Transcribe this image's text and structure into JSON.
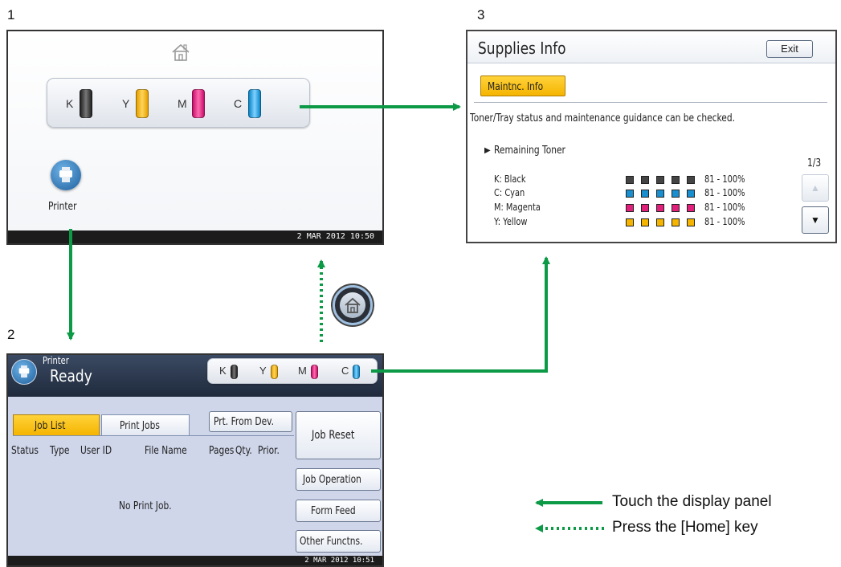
{
  "labels": {
    "n1": "1",
    "n2": "2",
    "n3": "3"
  },
  "screen1": {
    "toner": [
      {
        "key": "K",
        "color": "#3a3a3a"
      },
      {
        "key": "Y",
        "color": "#f5b400"
      },
      {
        "key": "M",
        "color": "#e0207a"
      },
      {
        "key": "C",
        "color": "#1aa0e0"
      }
    ],
    "printer_label": "Printer",
    "datetime": "2 MAR   2012 10:50"
  },
  "screen2": {
    "app_label": "Printer",
    "status": "Ready",
    "toner": [
      "K",
      "Y",
      "M",
      "C"
    ],
    "tabs": [
      "Job List",
      "Print Jobs"
    ],
    "prt_from_dev": "Prt. From Dev.",
    "columns": [
      "Status",
      "Type",
      "User ID",
      "File Name",
      "Pages",
      "Qty.",
      "Prior."
    ],
    "empty_message": "No Print Job.",
    "job_reset": "Job Reset",
    "job_operation": "Job Operation",
    "form_feed": "Form Feed",
    "other_functns": "Other Functns.",
    "datetime": "2 MAR   2012 10:51"
  },
  "screen3": {
    "title": "Supplies Info",
    "exit": "Exit",
    "maint_tab": "Maintnc. Info",
    "description": "Toner/Tray status and maintenance guidance can be checked.",
    "section": "Remaining Toner",
    "page": "1/3",
    "rows": [
      {
        "label": "K: Black",
        "color": "#444444",
        "level": "81 - 100%"
      },
      {
        "label": "C: Cyan",
        "color": "#1a8fd0",
        "level": "81 - 100%"
      },
      {
        "label": "M: Magenta",
        "color": "#e0207a",
        "level": "81 - 100%"
      },
      {
        "label": "Y: Yellow",
        "color": "#f5b400",
        "level": "81 - 100%"
      }
    ]
  },
  "legend": {
    "touch": "Touch the display panel",
    "press": "Press the [Home] key"
  },
  "colors": {
    "arrow": "#0d9a47"
  }
}
